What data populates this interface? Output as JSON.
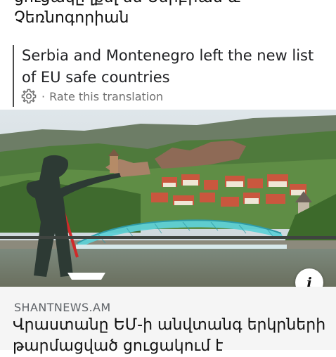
{
  "article_top": {
    "title_line1": "ցուցակը լքել են Սերբիան և",
    "title_line2": "Չեռնոգորիան"
  },
  "translation": {
    "text": "Serbia and Montenegro left the new list of EU safe countries",
    "rate_label": "Rate this translation",
    "separator": "·",
    "icon": "gear-icon"
  },
  "image": {
    "subject": "Tbilisi Bridge of Peace with old town and fortress"
  },
  "info_button": {
    "label": "i"
  },
  "card": {
    "source": "SHANTNEWS.AM",
    "headline": "Վրաստանը ԵՄ-ի անվտանգ երկրների թարմացված ցուցակում է"
  },
  "colors": {
    "border": "#4a4a4a",
    "muted_text": "#6f6f6f",
    "card_bg": "#f5f5f5",
    "bridge": "#5fd1d6"
  }
}
